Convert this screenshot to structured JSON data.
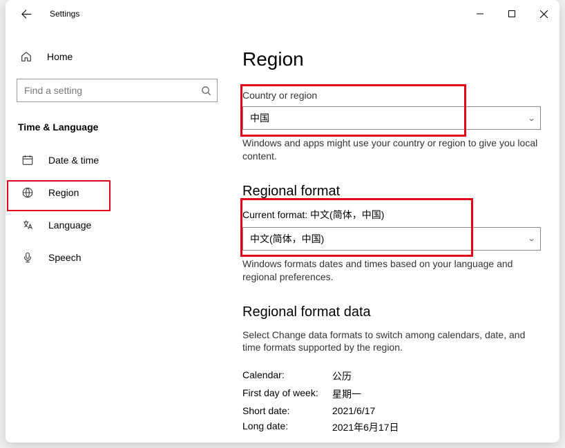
{
  "titlebar": {
    "app_title": "Settings"
  },
  "sidebar": {
    "home_label": "Home",
    "search_placeholder": "Find a setting",
    "group_header": "Time & Language",
    "items": [
      {
        "label": "Date & time"
      },
      {
        "label": "Region"
      },
      {
        "label": "Language"
      },
      {
        "label": "Speech"
      }
    ]
  },
  "main": {
    "page_title": "Region",
    "country": {
      "label": "Country or region",
      "value": "中国",
      "help": "Windows and apps might use your country or region to give you local content."
    },
    "regional_format": {
      "heading": "Regional format",
      "current_label": "Current format:",
      "current_value": "中文(简体，中国)",
      "select_value": "中文(简体，中国)",
      "help": "Windows formats dates and times based on your language and regional preferences."
    },
    "format_data": {
      "heading": "Regional format data",
      "help": "Select Change data formats to switch among calendars, date, and time formats supported by the region.",
      "rows": [
        {
          "k": "Calendar:",
          "v": "公历"
        },
        {
          "k": "First day of week:",
          "v": "星期一"
        },
        {
          "k": "Short date:",
          "v": "2021/6/17"
        },
        {
          "k": "Long date:",
          "v": "2021年6月17日"
        }
      ]
    }
  }
}
